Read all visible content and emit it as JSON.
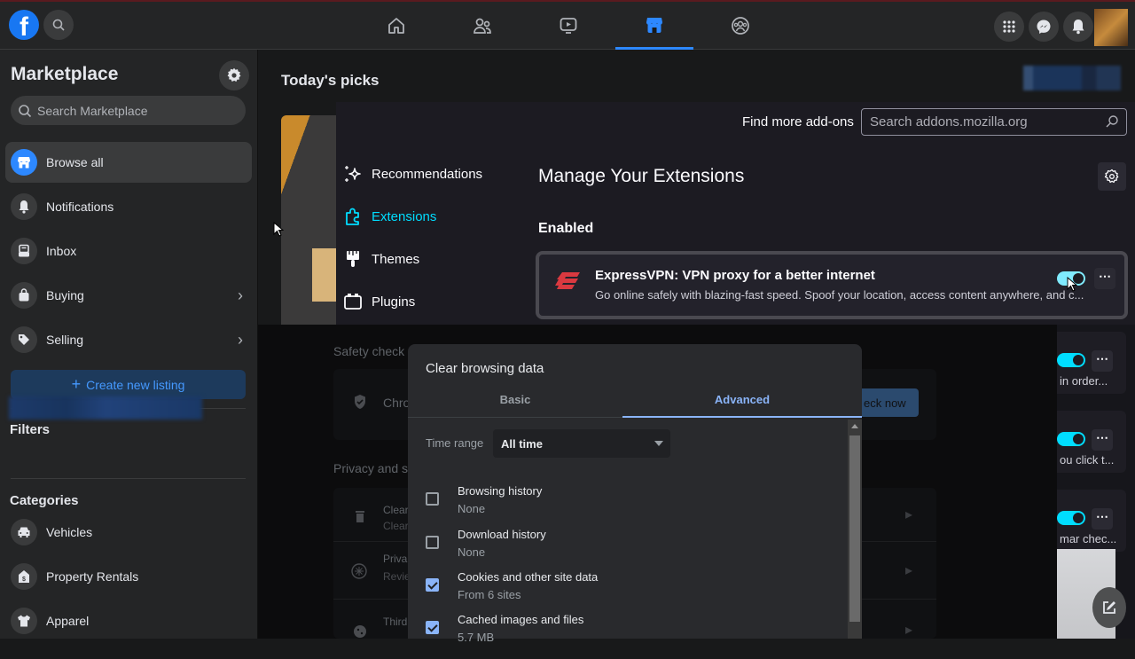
{
  "facebook": {
    "nav_tabs": [
      {
        "name": "home",
        "icon": "home-icon",
        "active": false
      },
      {
        "name": "friends",
        "icon": "friends-icon",
        "active": false
      },
      {
        "name": "watch",
        "icon": "video-icon",
        "active": false
      },
      {
        "name": "marketplace",
        "icon": "marketplace-icon",
        "active": true
      },
      {
        "name": "groups",
        "icon": "groups-icon",
        "active": false
      }
    ],
    "accent": "#2d88ff",
    "sidebar": {
      "title": "Marketplace",
      "search_placeholder": "Search Marketplace",
      "items": [
        {
          "label": "Browse all",
          "icon": "storefront-icon",
          "active": true
        },
        {
          "label": "Notifications",
          "icon": "bell-icon"
        },
        {
          "label": "Inbox",
          "icon": "inbox-icon"
        },
        {
          "label": "Buying",
          "icon": "shopping-bag-icon",
          "has_chevron": true
        },
        {
          "label": "Selling",
          "icon": "tag-icon",
          "has_chevron": true
        }
      ],
      "create_listing": "Create new listing",
      "filters_heading": "Filters",
      "categories_heading": "Categories",
      "categories": [
        {
          "label": "Vehicles",
          "icon": "car-icon"
        },
        {
          "label": "Property Rentals",
          "icon": "house-icon"
        },
        {
          "label": "Apparel",
          "icon": "shirt-icon"
        }
      ]
    },
    "main": {
      "heading": "Today's picks"
    }
  },
  "firefox_addons": {
    "nav": [
      {
        "label": "Recommendations",
        "icon": "sparkle-icon",
        "active": false
      },
      {
        "label": "Extensions",
        "icon": "puzzle-icon",
        "active": true
      },
      {
        "label": "Themes",
        "icon": "paintbrush-icon",
        "active": false
      },
      {
        "label": "Plugins",
        "icon": "plugin-icon",
        "active": false
      }
    ],
    "find_more": "Find more add-ons",
    "search_placeholder": "Search addons.mozilla.org",
    "title": "Manage Your Extensions",
    "section": "Enabled",
    "extension": {
      "name": "ExpressVPN: VPN proxy for a better internet",
      "description": "Go online safely with blazing-fast speed. Spoof your location, access content anywhere, and c...",
      "enabled": true
    },
    "other_extensions_text": [
      "in order...",
      "ou click t...",
      "mar chec..."
    ]
  },
  "chrome_settings_bg": {
    "safety_check": "Safety check",
    "chrome_row": "Chro",
    "check_now": "eck now",
    "privacy": "Privacy and s",
    "rows": [
      {
        "title": "Clear",
        "sub": "Clear"
      },
      {
        "title": "Priva",
        "sub": "Revie"
      },
      {
        "title": "Third",
        "sub": ""
      }
    ]
  },
  "clear_browsing_dialog": {
    "title": "Clear browsing data",
    "tabs": [
      {
        "label": "Basic",
        "active": false
      },
      {
        "label": "Advanced",
        "active": true
      }
    ],
    "time_range_label": "Time range",
    "time_range_value": "All time",
    "options": [
      {
        "label": "Browsing history",
        "detail": "None",
        "checked": false
      },
      {
        "label": "Download history",
        "detail": "None",
        "checked": false
      },
      {
        "label": "Cookies and other site data",
        "detail": "From 6 sites",
        "checked": true
      },
      {
        "label": "Cached images and files",
        "detail": "5.7 MB",
        "checked": true
      }
    ]
  }
}
